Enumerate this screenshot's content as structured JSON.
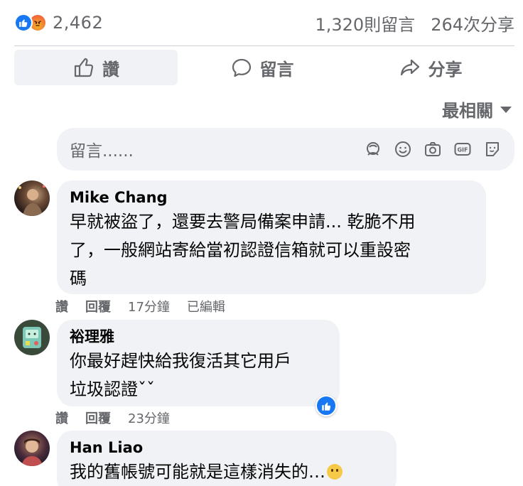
{
  "stats": {
    "reaction_count": "2,462",
    "comments": "1,320則留言",
    "shares": "264次分享"
  },
  "actions": {
    "like": "讚",
    "comment": "留言",
    "share": "分享"
  },
  "sort": {
    "label": "最相關"
  },
  "input": {
    "placeholder": "留言......",
    "icons": [
      "avatar-sticker-icon",
      "emoji-icon",
      "camera-icon",
      "gif-icon",
      "sticker-icon"
    ]
  },
  "comments": [
    {
      "author": "Mike Chang",
      "lines": [
        "早就被盜了，還要去警局備案申請... 乾脆不用",
        "了，一般網站寄給當初認證信箱就可以重設密",
        "碼"
      ],
      "like": "讚",
      "reply": "回覆",
      "time": "17分鐘",
      "edited": "已編輯"
    },
    {
      "author": "裕理雅",
      "lines": [
        "你最好趕快給我復活其它用戶",
        "垃圾認證ˇˇ"
      ],
      "like": "讚",
      "reply": "回覆",
      "time": "23分鐘"
    },
    {
      "author": "Han Liao",
      "lines": [
        "我的舊帳號可能就是這樣消失的…"
      ],
      "emoji": "smiling-face-with-tear-emoji"
    }
  ],
  "colors": {
    "accent": "#1877f2",
    "secondary_text": "#65676b",
    "bubble_bg": "#f0f2f5"
  }
}
